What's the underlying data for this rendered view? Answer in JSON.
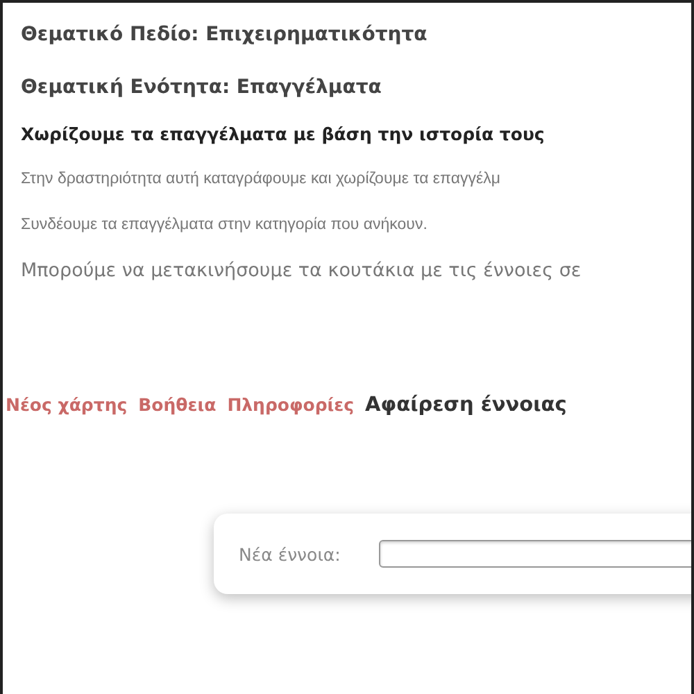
{
  "headings": [
    {
      "kind": "field",
      "text": "Θεματικό Πεδίο: Επιχειρηματικότητα"
    },
    {
      "kind": "unit",
      "text": "Θεματική Ενότητα: Επαγγέλματα"
    },
    {
      "kind": "activity",
      "text": "Χωρίζουμε τα επαγγέλματα με βάση την ιστορία τους"
    }
  ],
  "paragraphs": [
    {
      "kind": "small",
      "text": "Στην δραστηριότητα αυτή καταγράφουμε και χωρίζουμε τα επαγγέλμ"
    },
    {
      "kind": "small",
      "text": "Συνδέουμε τα επαγγέλματα στην κατηγορία που ανήκουν."
    },
    {
      "kind": "large",
      "text": "Μπορούμε να μετακινήσουμε τα κουτάκια με τις  έννοιες σε"
    }
  ],
  "menu": [
    {
      "label": "Νέος χάρτης",
      "selected": false
    },
    {
      "label": "Βοήθεια",
      "selected": false
    },
    {
      "label": "Πληροφορίες",
      "selected": false
    },
    {
      "label": "Αφαίρεση έννοιας",
      "selected": true
    }
  ],
  "new_concept": {
    "label": "Νέα έννοια:"
  }
}
